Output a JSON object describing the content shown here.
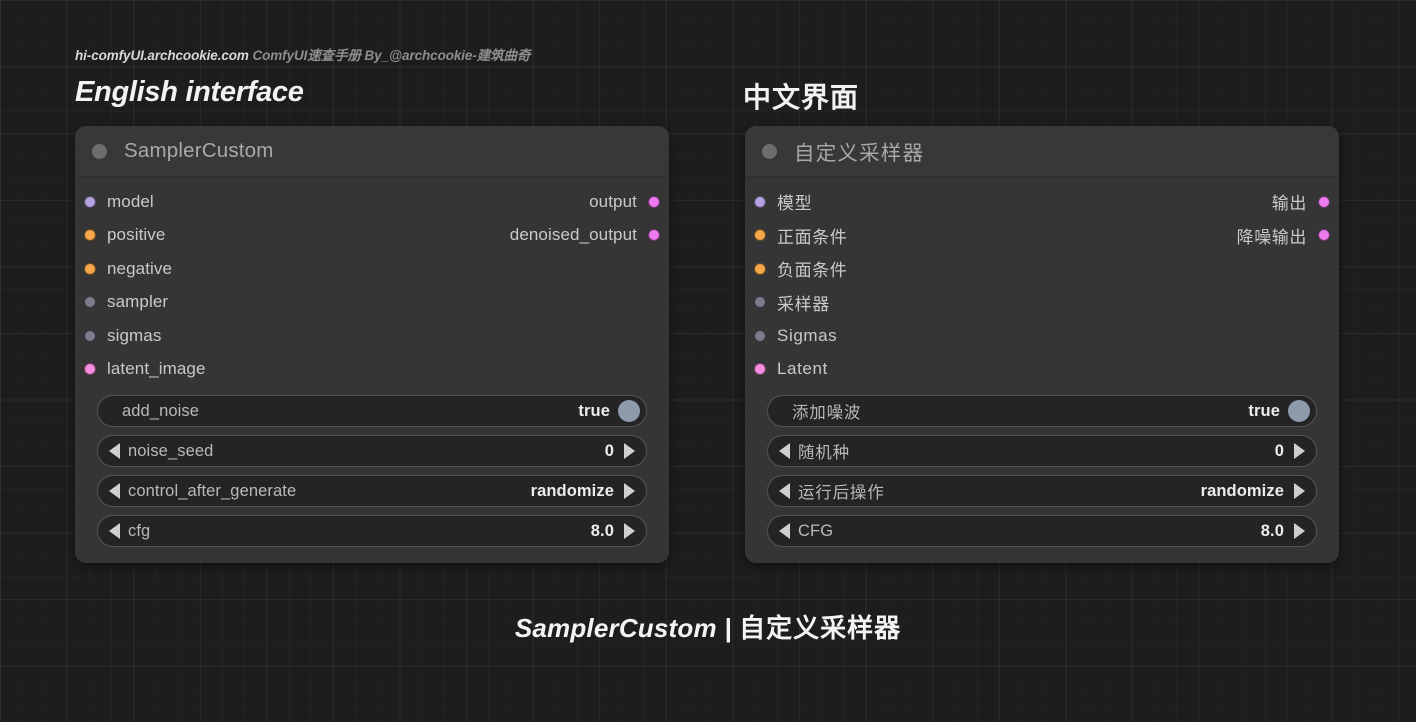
{
  "credit": {
    "site": "hi-comfyUI.archcookie.com",
    "tagline": "ComfyUI速查手册  By_@archcookie-建筑曲奇"
  },
  "headings": {
    "english": "English interface",
    "chinese": "中文界面"
  },
  "caption": {
    "english": "SamplerCustom | ",
    "chinese": "自定义采样器"
  },
  "colors": {
    "background": "#1d1d1d",
    "node_body": "#353535",
    "node_header": "#383838",
    "widget_bg": "#242424",
    "widget_border": "#545454",
    "dot_model": "#b3a1e0",
    "dot_conditioning": "#f5a64a",
    "dot_sampler": "#7b7b8c",
    "dot_latent": "#f58ce0",
    "dot_output": "#ee7bee",
    "collapse_dot": "#6d6d6d",
    "toggle_knob": "#8e9aab",
    "title_text": "#a8a8a8",
    "slot_text": "#c9c9c9"
  },
  "nodes": [
    {
      "id": "english",
      "title": "SamplerCustom",
      "collapse_icon": "collapse-dot-icon",
      "inputs": [
        {
          "label": "model",
          "color": "#b3a1e0"
        },
        {
          "label": "positive",
          "color": "#f5a64a"
        },
        {
          "label": "negative",
          "color": "#f5a64a"
        },
        {
          "label": "sampler",
          "color": "#7b7b8c"
        },
        {
          "label": "sigmas",
          "color": "#7b7b8c"
        },
        {
          "label": "latent_image",
          "color": "#f58ce0"
        }
      ],
      "outputs": [
        {
          "label": "output",
          "color": "#ee7bee"
        },
        {
          "label": "denoised_output",
          "color": "#ee7bee"
        }
      ],
      "widgets": [
        {
          "type": "toggle",
          "name": "add_noise",
          "value": "true"
        },
        {
          "type": "spin",
          "name": "noise_seed",
          "value": "0"
        },
        {
          "type": "spin",
          "name": "control_after_generate",
          "value": "randomize"
        },
        {
          "type": "spin",
          "name": "cfg",
          "value": "8.0"
        }
      ]
    },
    {
      "id": "chinese",
      "title": "自定义采样器",
      "collapse_icon": "collapse-dot-icon",
      "inputs": [
        {
          "label": "模型",
          "color": "#b3a1e0"
        },
        {
          "label": "正面条件",
          "color": "#f5a64a"
        },
        {
          "label": "负面条件",
          "color": "#f5a64a"
        },
        {
          "label": "采样器",
          "color": "#7b7b8c"
        },
        {
          "label": "Sigmas",
          "color": "#7b7b8c"
        },
        {
          "label": "Latent",
          "color": "#f58ce0"
        }
      ],
      "outputs": [
        {
          "label": "输出",
          "color": "#ee7bee"
        },
        {
          "label": "降噪输出",
          "color": "#ee7bee"
        }
      ],
      "widgets": [
        {
          "type": "toggle",
          "name": "添加噪波",
          "value": "true"
        },
        {
          "type": "spin",
          "name": "随机种",
          "value": "0"
        },
        {
          "type": "spin",
          "name": "运行后操作",
          "value": "randomize"
        },
        {
          "type": "spin",
          "name": "CFG",
          "value": "8.0"
        }
      ]
    }
  ]
}
